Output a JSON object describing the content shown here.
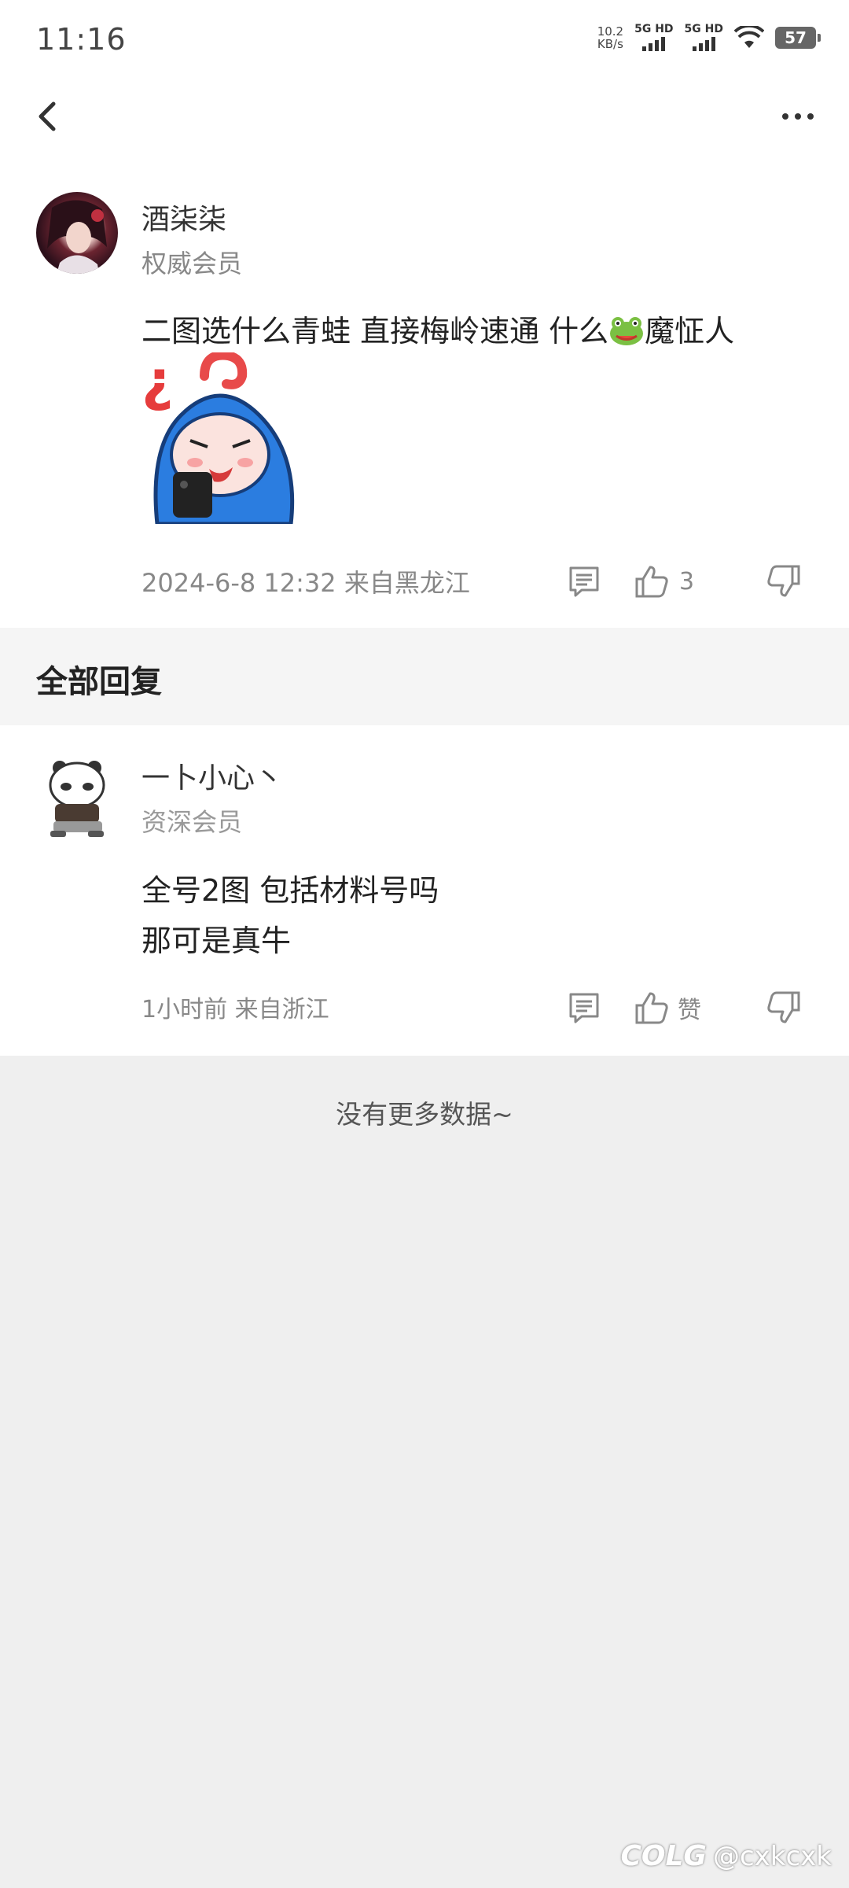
{
  "status_bar": {
    "time": "11:16",
    "net_speed_value": "10.2",
    "net_speed_unit": "KB/s",
    "sim1_label": "5G HD",
    "sim2_label": "5G HD",
    "battery": "57"
  },
  "post": {
    "user_name": "酒柒柒",
    "user_level": "权威会员",
    "text_before_emoji": "二图选什么青蛙 直接梅岭速通 什么",
    "text_after_emoji": "魔怔人",
    "date": "2024-6-8 12:32",
    "location": "来自黑龙江",
    "like_count": "3"
  },
  "section": {
    "title": "全部回复"
  },
  "reply": {
    "user_name": "一卜小心丶",
    "user_level": "资深会员",
    "line1": "全号2图 包括材料号吗",
    "line2": "那可是真牛",
    "time": "1小时前",
    "location": "来自浙江",
    "like_label": "赞"
  },
  "footer": {
    "no_more": "没有更多数据~"
  },
  "watermark": {
    "logo": "COLG",
    "handle": "@cxkcxk"
  },
  "icons": {
    "back": "chevron-left-icon",
    "more": "more-dots-icon",
    "reply": "comment-icon",
    "like": "thumbs-up-icon",
    "dislike": "thumbs-down-icon"
  }
}
